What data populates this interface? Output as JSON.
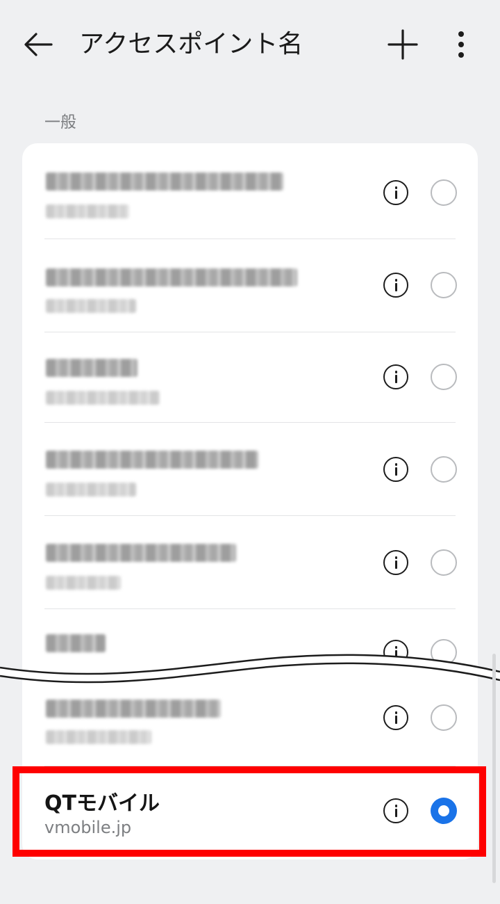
{
  "header": {
    "title": "アクセスポイント名",
    "back_icon": "arrow-left-icon",
    "add_icon": "plus-icon",
    "more_icon": "more-vertical-icon"
  },
  "section": {
    "label": "一般"
  },
  "apn_list": [
    {
      "name": "",
      "value": "",
      "obscured": true,
      "selected": false
    },
    {
      "name": "",
      "value": "",
      "obscured": true,
      "selected": false
    },
    {
      "name": "",
      "value": "",
      "obscured": true,
      "selected": false
    },
    {
      "name": "",
      "value": "",
      "obscured": true,
      "selected": false
    },
    {
      "name": "",
      "value": "",
      "obscured": true,
      "selected": false
    },
    {
      "name": "",
      "value": "",
      "obscured": true,
      "selected": false
    },
    {
      "name": "",
      "value": "",
      "obscured": true,
      "selected": false
    },
    {
      "name": "QTモバイル",
      "value": "vmobile.jp",
      "obscured": false,
      "selected": true
    }
  ],
  "colors": {
    "background": "#eff0f2",
    "card": "#ffffff",
    "accent": "#1a73e8",
    "highlight": "#fe0000"
  }
}
